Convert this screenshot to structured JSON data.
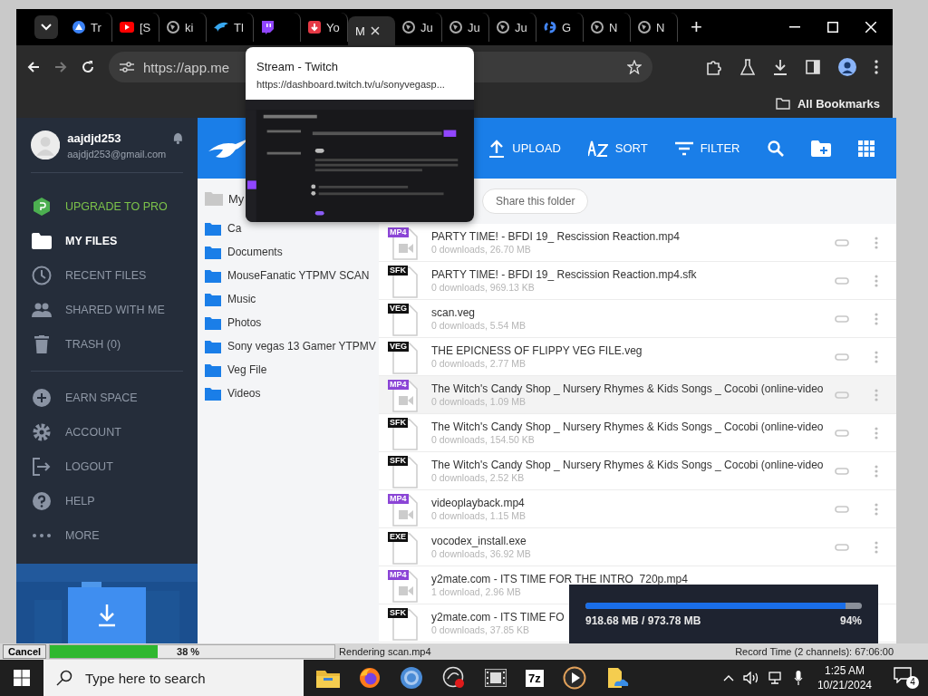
{
  "browser": {
    "tabs": [
      {
        "kind": "drive",
        "label": "Tr",
        "selected": false
      },
      {
        "kind": "youtube",
        "label": "[S",
        "selected": false
      },
      {
        "kind": "globe",
        "label": "ki",
        "selected": false
      },
      {
        "kind": "wing",
        "label": "Tl",
        "selected": false
      },
      {
        "kind": "twitch",
        "selected": false
      },
      {
        "kind": "download",
        "label": "Yo",
        "selected": false
      },
      {
        "kind": "none",
        "label": "M",
        "selected": true
      },
      {
        "kind": "globe",
        "label": "Ju",
        "selected": false
      },
      {
        "kind": "globe",
        "label": "Ju",
        "selected": false
      },
      {
        "kind": "globe",
        "label": "Ju",
        "selected": false
      },
      {
        "kind": "google",
        "label": "G",
        "selected": false
      },
      {
        "kind": "globe",
        "label": "N",
        "selected": false
      },
      {
        "kind": "globe",
        "label": "N",
        "selected": false
      }
    ],
    "new_tab": "+",
    "address": "https://app.me",
    "bookmarks": "All Bookmarks",
    "tooltip": {
      "title": "Stream - Twitch",
      "url": "https://dashboard.twitch.tv/u/sonyvegasp..."
    }
  },
  "profile": {
    "name": "aajdjd253",
    "email": "aajdjd253@gmail.com"
  },
  "sidebar": {
    "sections": [
      [
        {
          "kind": "upgrade",
          "label": "UPGRADE TO PRO",
          "selected": false
        },
        {
          "kind": "folder",
          "label": "MY FILES",
          "selected": true
        },
        {
          "kind": "clock",
          "label": "RECENT FILES",
          "selected": false
        },
        {
          "kind": "people",
          "label": "SHARED WITH ME",
          "selected": false
        },
        {
          "kind": "trash",
          "label": "TRASH (0)",
          "selected": false
        }
      ],
      [
        {
          "kind": "plus",
          "label": "EARN SPACE",
          "selected": false
        },
        {
          "kind": "gear",
          "label": "ACCOUNT",
          "selected": false
        },
        {
          "kind": "logout",
          "label": "LOGOUT",
          "selected": false
        },
        {
          "kind": "help",
          "label": "HELP",
          "selected": false
        },
        {
          "kind": "more",
          "label": "MORE",
          "selected": false
        }
      ]
    ]
  },
  "toolbar": [
    {
      "kind": "upload",
      "label": "UPLOAD"
    },
    {
      "kind": "sort",
      "label": "SORT"
    },
    {
      "kind": "filter",
      "label": "FILTER"
    },
    {
      "kind": "search"
    },
    {
      "kind": "new-folder"
    },
    {
      "kind": "grid"
    }
  ],
  "breadcrumb": "My",
  "share_button": "Share this folder",
  "folders": [
    "Ca",
    "Documents",
    "MouseFanatic YTPMV SCAN",
    "Music",
    "Photos",
    "Sony vegas 13 Gamer YTPMV",
    "Veg File",
    "Videos"
  ],
  "files": [
    {
      "kind": "video",
      "badge": "MP4",
      "name": "PARTY TIME! - BFDI 19_ Rescission Reaction.mp4",
      "meta": "0 downloads, 26.70 MB",
      "hovered": false,
      "actions": true
    },
    {
      "kind": "file",
      "badge": "SFK",
      "name": "PARTY TIME! - BFDI 19_ Rescission Reaction.mp4.sfk",
      "meta": "0 downloads, 969.13 KB",
      "hovered": false,
      "actions": true
    },
    {
      "kind": "file",
      "badge": "VEG",
      "name": "scan.veg",
      "meta": "0 downloads, 5.54 MB",
      "hovered": false,
      "actions": true
    },
    {
      "kind": "file",
      "badge": "VEG",
      "name": "THE EPICNESS OF FLIPPY VEG FILE.veg",
      "meta": "0 downloads, 2.77 MB",
      "hovered": false,
      "actions": true
    },
    {
      "kind": "video",
      "badge": "MP4",
      "name": "The Witch's Candy Shop _ Nursery Rhymes & Kids Songs _ Cocobi (online-video",
      "meta": "0 downloads, 1.09 MB",
      "hovered": true,
      "actions": true
    },
    {
      "kind": "file",
      "badge": "SFK",
      "name": "The Witch's Candy Shop _ Nursery Rhymes & Kids Songs _ Cocobi (online-video",
      "meta": "0 downloads, 154.50 KB",
      "hovered": false,
      "actions": true
    },
    {
      "kind": "file",
      "badge": "SFK",
      "name": "The Witch's Candy Shop _ Nursery Rhymes & Kids Songs _ Cocobi (online-video",
      "meta": "0 downloads, 2.52 KB",
      "hovered": false,
      "actions": true
    },
    {
      "kind": "video",
      "badge": "MP4",
      "name": "videoplayback.mp4",
      "meta": "0 downloads, 1.15 MB",
      "hovered": false,
      "actions": true
    },
    {
      "kind": "file",
      "badge": "EXE",
      "name": "vocodex_install.exe",
      "meta": "0 downloads, 36.92 MB",
      "hovered": false,
      "actions": true
    },
    {
      "kind": "video",
      "badge": "MP4",
      "name": "y2mate.com - ITS TIME FOR THE INTRO_720p.mp4",
      "meta": "1 download, 2.96 MB",
      "hovered": false,
      "actions": false
    },
    {
      "kind": "file",
      "badge": "SFK",
      "name": "y2mate.com - ITS TIME FO",
      "meta": "0 downloads, 37.85 KB",
      "hovered": false,
      "actions": false
    }
  ],
  "download": {
    "reading": "918.68 MB / 973.78 MB",
    "percent": "94%",
    "level": 0.94
  },
  "render_bar": {
    "cancel": "Cancel",
    "level": 0.38,
    "percent": "38 %",
    "status": "Rendering scan.mp4",
    "record_time": "Record Time (2 channels): 67:06:00"
  },
  "taskbar": {
    "search_placeholder": "Type here to search",
    "apps": [
      {
        "kind": "explorer"
      },
      {
        "kind": "firefox"
      },
      {
        "kind": "chrome"
      },
      {
        "kind": "recorder"
      },
      {
        "kind": "vegas"
      },
      {
        "kind": "archive",
        "label": "7z"
      },
      {
        "kind": "player"
      },
      {
        "kind": "cloud-files"
      }
    ],
    "time": "1:25 AM",
    "date": "10/21/2024",
    "notifications": "4"
  }
}
